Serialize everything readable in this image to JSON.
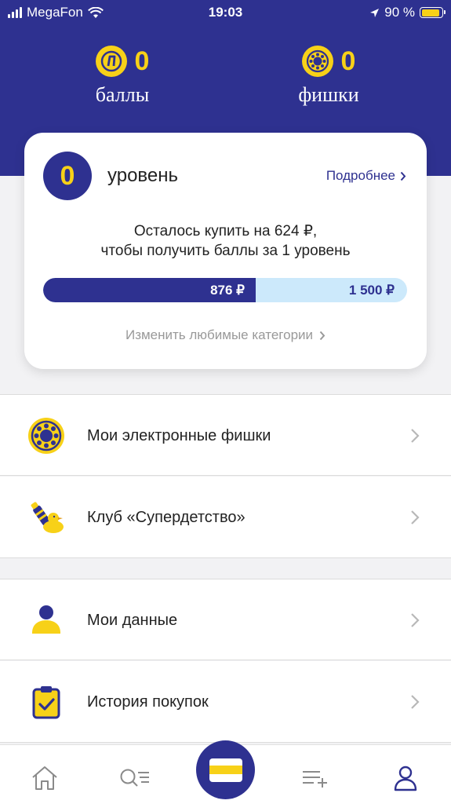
{
  "status_bar": {
    "carrier": "MegaFon",
    "time": "19:03",
    "battery_percent": "90 %",
    "battery_level": 0.9
  },
  "balance": {
    "points_value": "0",
    "points_label": "баллы",
    "chips_value": "0",
    "chips_label": "фишки"
  },
  "level_card": {
    "level_number": "0",
    "level_title": "уровень",
    "details_link": "Подробнее",
    "remaining_text_line1": "Осталось купить на 624 ₽,",
    "remaining_text_line2": "чтобы получить баллы за 1 уровень",
    "progress_current": "876 ₽",
    "progress_target": "1 500 ₽",
    "progress_fraction": 0.584,
    "change_categories_link": "Изменить любимые категории"
  },
  "menu": {
    "items": [
      {
        "label": "Мои электронные фишки",
        "icon": "sun-chip-icon"
      },
      {
        "label": "Клуб «Супердетство»",
        "icon": "baby-bottle-duck-icon"
      },
      {
        "label": "Мои данные",
        "icon": "user-icon"
      },
      {
        "label": "История покупок",
        "icon": "clipboard-check-icon"
      }
    ]
  },
  "tab_bar": {
    "tabs": [
      "home-icon",
      "search-list-icon",
      "card-icon",
      "shopping-list-icon",
      "profile-icon"
    ]
  },
  "colors": {
    "brand_blue": "#2e3190",
    "brand_yellow": "#f7d118",
    "progress_track": "#cce9fb"
  }
}
